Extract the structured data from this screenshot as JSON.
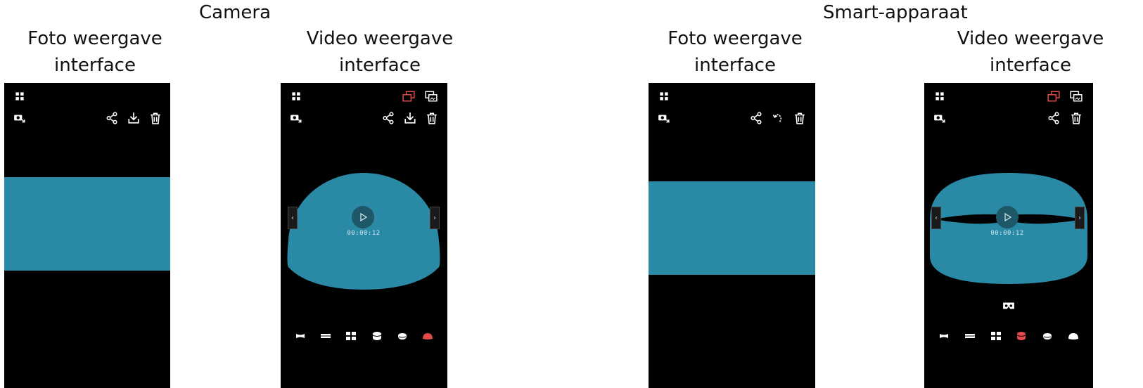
{
  "colors": {
    "screen": "#000000",
    "media": "#2a8aa5",
    "accent": "#e24b4b",
    "icon": "#ffffff"
  },
  "sections": {
    "camera": {
      "title": "Camera"
    },
    "smart": {
      "title": "Smart-apparaat"
    }
  },
  "panels": [
    {
      "label_line1": "Foto weergave",
      "label_line2": "interface"
    },
    {
      "label_line1": "Video weergave",
      "label_line2": "interface",
      "time": "00:00:12"
    },
    {
      "label_line1": "Foto weergave",
      "label_line2": "interface"
    },
    {
      "label_line1": "Video weergave",
      "label_line2": "interface",
      "time": "00:00:12"
    }
  ],
  "icons": {
    "grid": "grid-icon",
    "camera_switch": "camera-switch-icon",
    "share": "share-icon",
    "download": "download-icon",
    "delete": "trash-icon",
    "rotate": "rotate-icon",
    "view_mode_a": "view-mode-icon",
    "view_mode_b": "view-mode-alt-icon",
    "vr": "vr-headset-icon",
    "play": "play-icon",
    "prev": "chevron-left-icon",
    "next": "chevron-right-icon"
  },
  "mode_icons": [
    "panorama-mode-icon",
    "single-view-icon",
    "quad-view-icon",
    "cylinder-view-icon",
    "bowl-view-icon",
    "dome-view-icon"
  ]
}
